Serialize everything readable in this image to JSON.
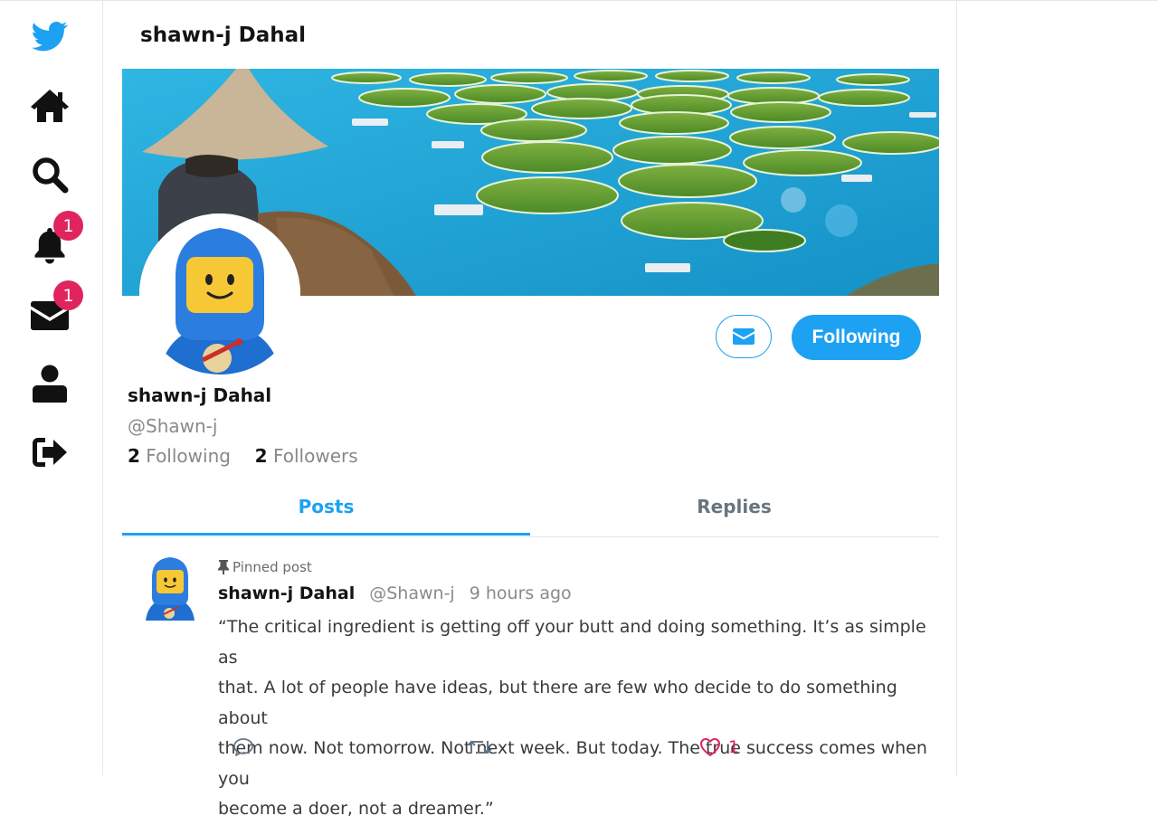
{
  "colors": {
    "accent": "#1da1f2",
    "badge": "#e0245e",
    "like": "#e0245e"
  },
  "sidebar": {
    "items": [
      {
        "name": "twitter-logo-icon"
      },
      {
        "name": "home-icon"
      },
      {
        "name": "search-icon"
      },
      {
        "name": "bell-icon",
        "badge": "1"
      },
      {
        "name": "envelope-icon",
        "badge": "1"
      },
      {
        "name": "user-icon"
      },
      {
        "name": "sign-out-icon"
      }
    ]
  },
  "header": {
    "title": "shawn-j Dahal"
  },
  "profile": {
    "name": "shawn-j Dahal",
    "handle": "@Shawn-j",
    "following_count": "2",
    "following_label": "Following",
    "followers_count": "2",
    "followers_label": "Followers",
    "follow_button_label": "Following",
    "message_button_icon": "envelope-icon"
  },
  "tabs": [
    {
      "label": "Posts",
      "active": true
    },
    {
      "label": "Replies",
      "active": false
    }
  ],
  "post": {
    "pinned_label": "Pinned post",
    "author_name": "shawn-j Dahal",
    "author_handle": "@Shawn-j",
    "time": "9 hours ago",
    "text_lines": [
      "“The critical ingredient is getting off your butt and doing something. It’s as simple as",
      "that. A lot of people have ideas, but there are few who decide to do something about",
      "them now. Not tomorrow. Not next week. But today. The true success comes when you",
      "become a doer, not a dreamer.”"
    ],
    "like_count": "1"
  }
}
